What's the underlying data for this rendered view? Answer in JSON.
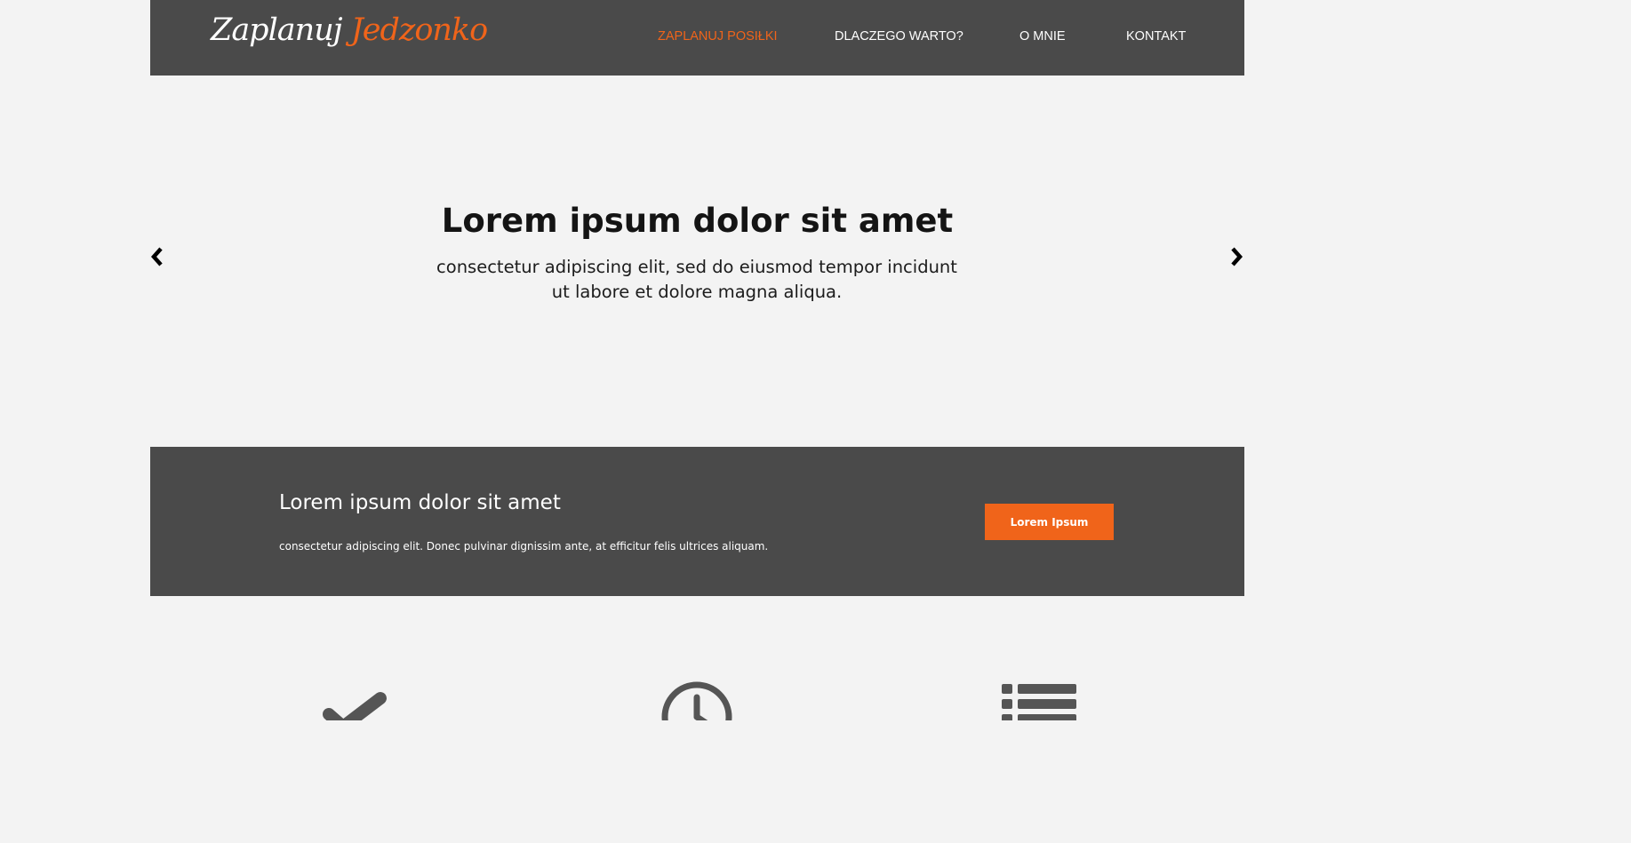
{
  "header": {
    "logo_part1": "Zaplanuj",
    "logo_part2": "Jedzonko",
    "nav": [
      {
        "label": "ZAPLANUJ POSIŁKI",
        "active": true
      },
      {
        "label": "DLACZEGO WARTO?",
        "active": false
      },
      {
        "label": "O MNIE",
        "active": false
      },
      {
        "label": "KONTAKT",
        "active": false
      }
    ]
  },
  "hero": {
    "title": "Lorem ipsum dolor sit amet",
    "subtitle": "consectetur adipiscing elit, sed do eiusmod tempor incidunt ut labore et dolore magna aliqua.",
    "prev_icon": "chevron-left-icon",
    "next_icon": "chevron-right-icon"
  },
  "cta": {
    "title": "Lorem ipsum dolor sit amet",
    "text": "consectetur adipiscing elit. Donec pulvinar dignissim ante, at efficitur felis ultrices aliquam.",
    "button_label": "Lorem Ipsum"
  },
  "features": [
    {
      "icon": "checkmark-icon"
    },
    {
      "icon": "clock-icon"
    },
    {
      "icon": "list-icon"
    }
  ],
  "colors": {
    "accent": "#f0641a",
    "dark": "#4a4a4a",
    "background": "#f3f3f3"
  }
}
